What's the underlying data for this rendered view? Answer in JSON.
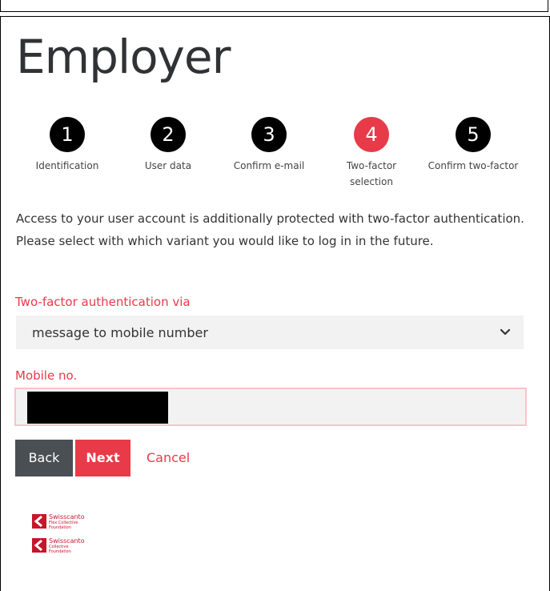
{
  "page": {
    "title": "Employer"
  },
  "steps": [
    {
      "number": "1",
      "label": "Identification",
      "state": "done"
    },
    {
      "number": "2",
      "label": "User data",
      "state": "done"
    },
    {
      "number": "3",
      "label": "Confirm e-mail",
      "state": "done"
    },
    {
      "number": "4",
      "label": "Two-factor selection",
      "state": "active"
    },
    {
      "number": "5",
      "label": "Confirm two-factor",
      "state": "pending"
    }
  ],
  "intro_text": "Access to your user account is additionally protected with two-factor authentication. Please select with which variant you would like to log in in the future.",
  "form": {
    "method_label": "Two-factor authentication via",
    "method_value": "message to mobile number",
    "mobile_label": "Mobile no.",
    "mobile_value": ""
  },
  "buttons": {
    "back": "Back",
    "next": "Next",
    "cancel": "Cancel"
  },
  "logos": [
    {
      "name": "Swisscanto",
      "sub1": "Flex Collective",
      "sub2": "Foundation"
    },
    {
      "name": "Swisscanto",
      "sub1": "Collective",
      "sub2": "Foundation"
    }
  ],
  "colors": {
    "accent": "#e83a48",
    "dark_button": "#4a4f54",
    "step_inactive": "#000000"
  },
  "icons": {
    "select": "chevron-down-icon",
    "logo": "swisscanto-logo-icon"
  }
}
